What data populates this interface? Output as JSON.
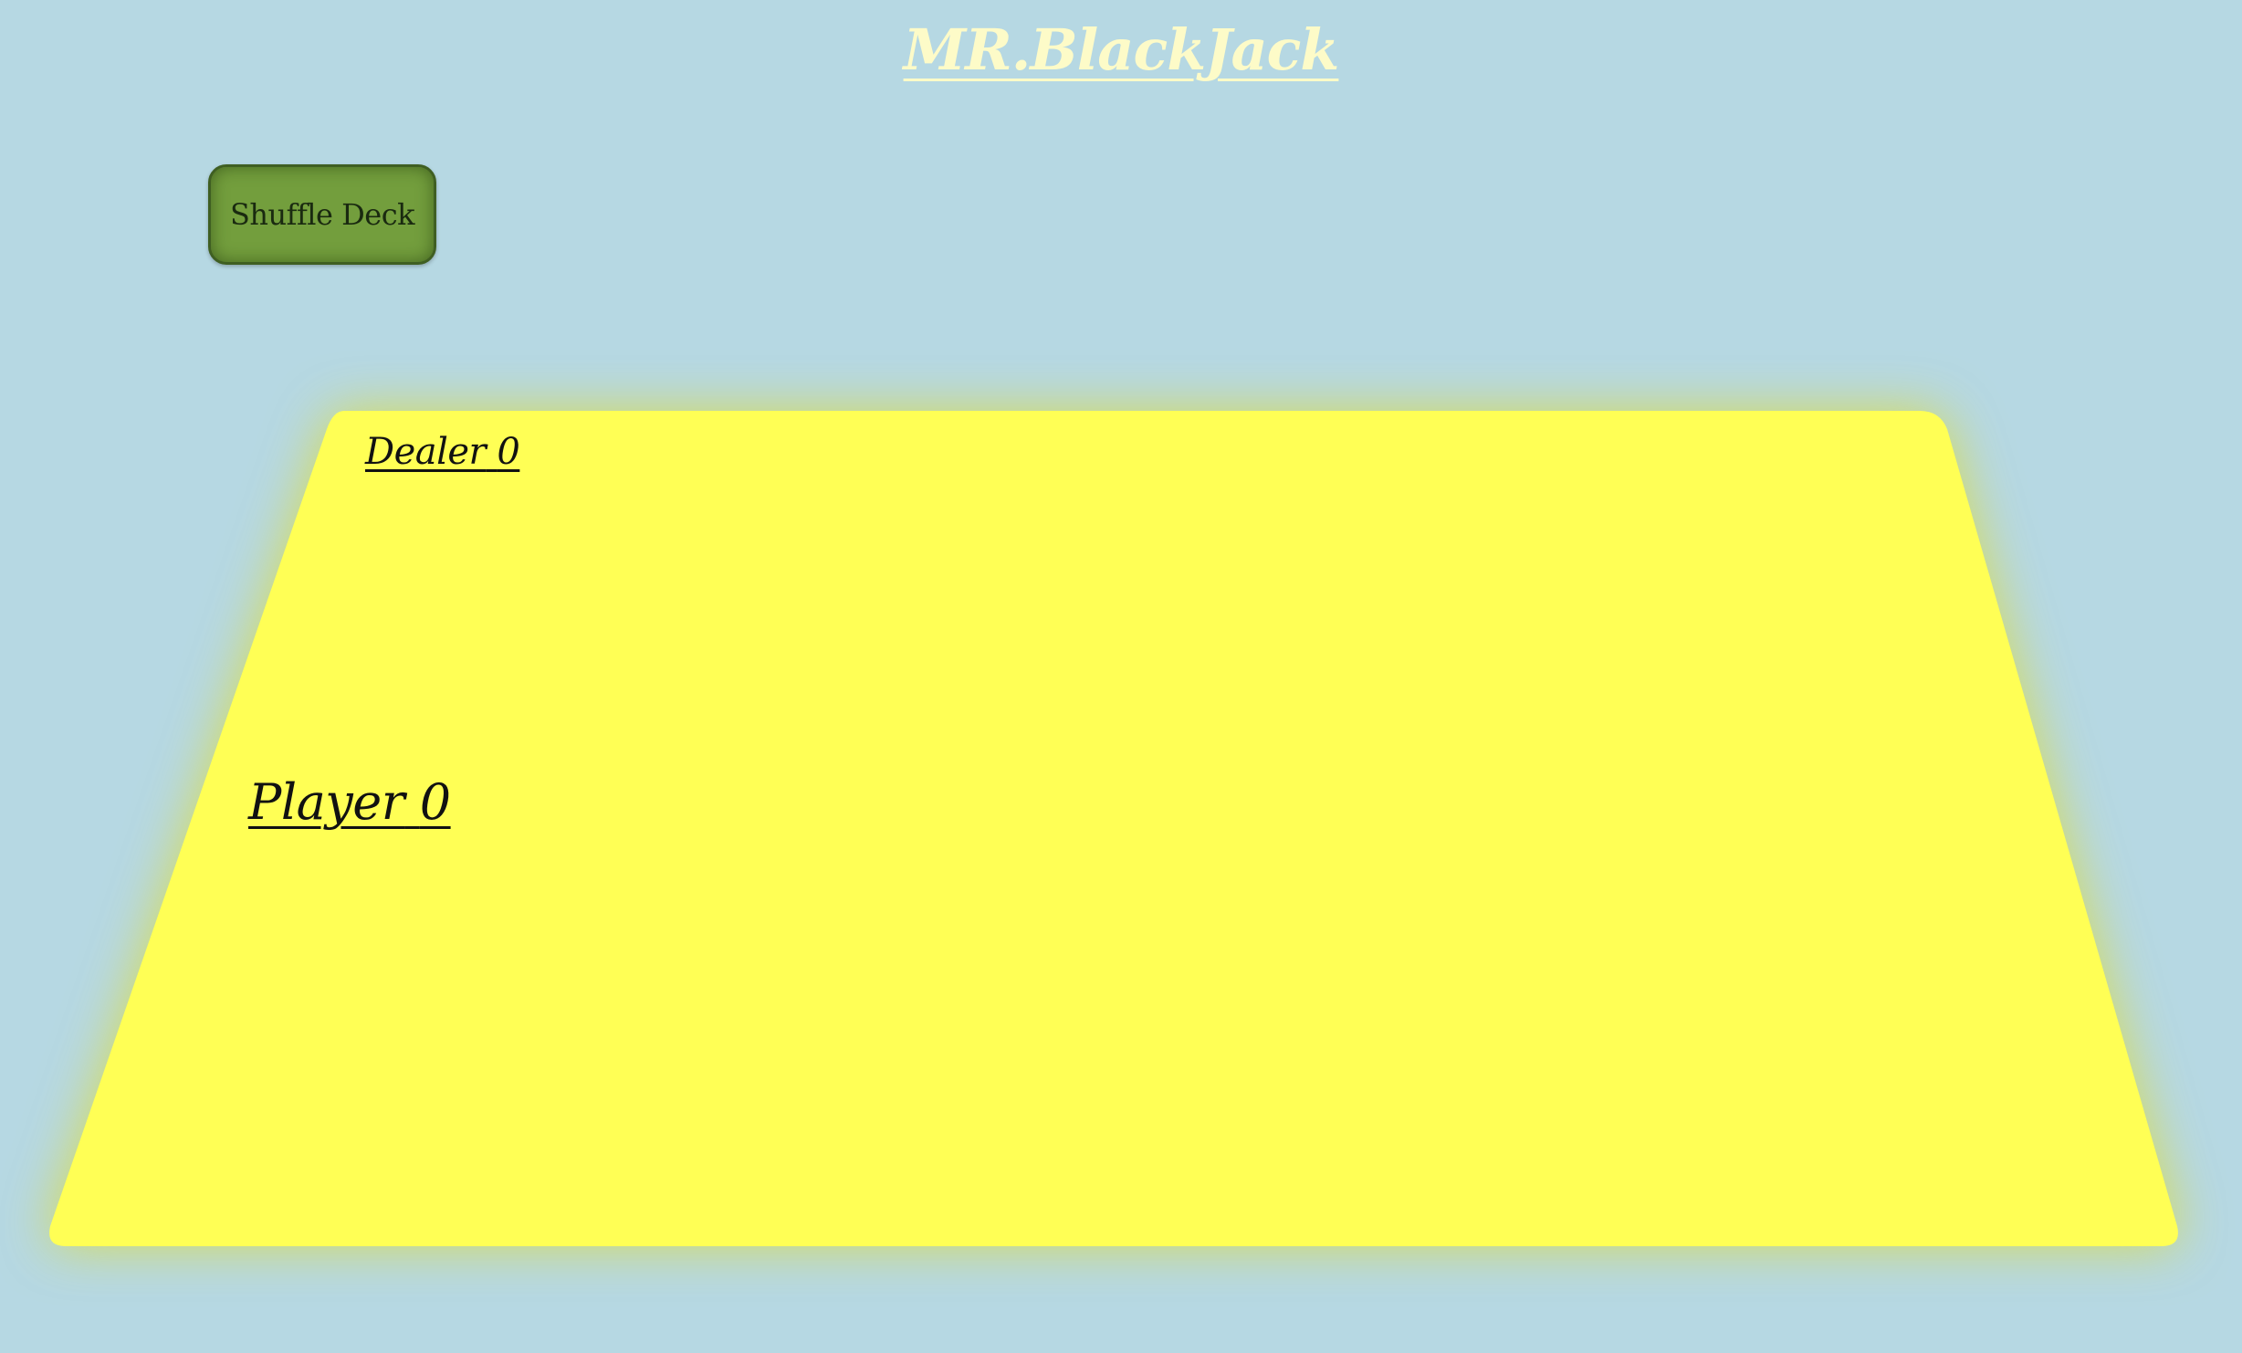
{
  "header": {
    "title": "MR.BlackJack"
  },
  "controls": {
    "shuffle_label": "Shuffle Deck"
  },
  "table": {
    "dealer_label": "Dealer",
    "dealer_score": "0",
    "player_label": "Player",
    "player_score": "0",
    "felt_color": "#ffff55",
    "glow_color": "#dcdc3c"
  },
  "theme": {
    "background": "#b6d8e3",
    "title_color": "#fdfbc8",
    "button_color": "#739e3d"
  }
}
